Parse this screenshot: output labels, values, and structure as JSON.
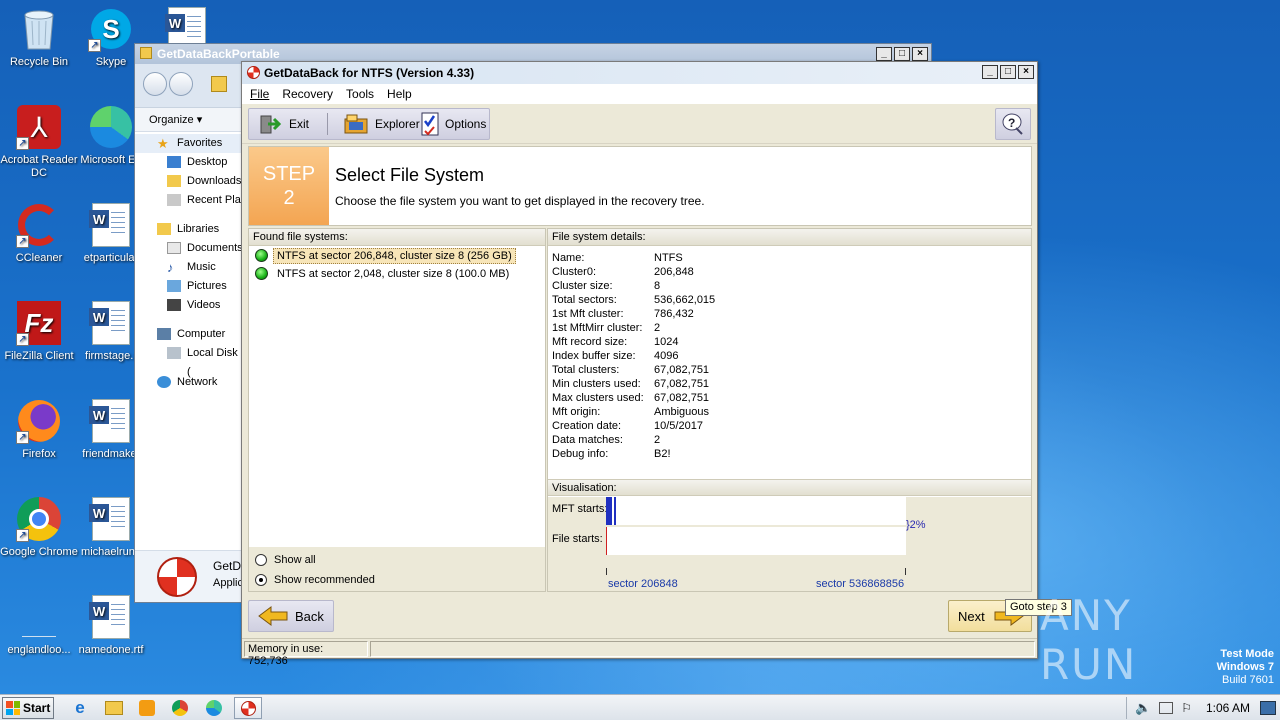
{
  "desktop": {
    "icons": [
      {
        "label": "Recycle Bin",
        "icon": "recycle-bin-icon"
      },
      {
        "label": "Skype",
        "icon": "skype-icon"
      },
      {
        "label": "Acrobat Reader DC",
        "icon": "acrobat-icon"
      },
      {
        "label": "Microsoft Ed",
        "icon": "edge-icon"
      },
      {
        "label": "CCleaner",
        "icon": "ccleaner-icon"
      },
      {
        "label": "etparticular",
        "icon": "word-doc-icon"
      },
      {
        "label": "FileZilla Client",
        "icon": "filezilla-icon"
      },
      {
        "label": "firmstage.r",
        "icon": "word-doc-icon"
      },
      {
        "label": "Firefox",
        "icon": "firefox-icon"
      },
      {
        "label": "friendmake.",
        "icon": "word-doc-icon"
      },
      {
        "label": "Google Chrome",
        "icon": "chrome-icon"
      },
      {
        "label": "michaelrunn",
        "icon": "word-doc-icon"
      },
      {
        "label": "englandloo...",
        "icon": "blank-file-icon"
      },
      {
        "label": "namedone.rtf",
        "icon": "word-doc-icon"
      }
    ],
    "watermark": "ANY RUN",
    "test_mode": {
      "line1": "Test Mode",
      "line2": "Windows 7",
      "line3": "Build 7601"
    }
  },
  "explorer": {
    "title": "GetDataBackPortable",
    "organize_label": "Organize",
    "nav": {
      "favorites": "Favorites",
      "desktop": "Desktop",
      "downloads": "Downloads",
      "recent": "Recent Pla",
      "libraries": "Libraries",
      "documents": "Documents",
      "music": "Music",
      "pictures": "Pictures",
      "videos": "Videos",
      "computer": "Computer",
      "local_disk": "Local Disk (",
      "network": "Network"
    },
    "details": {
      "name": "GetD",
      "type": "Applic"
    }
  },
  "gdb": {
    "title": "GetDataBack for NTFS (Version 4.33)",
    "menu": [
      "File",
      "Recovery",
      "Tools",
      "Help"
    ],
    "toolbar": {
      "exit": "Exit",
      "explorer": "Explorer",
      "options": "Options"
    },
    "step": {
      "word": "STEP",
      "number": "2"
    },
    "header_title": "Select File System",
    "header_desc": "Choose the file system you want to get displayed in the recovery tree.",
    "found_header": "Found file systems:",
    "file_systems": [
      {
        "label": "NTFS at sector 206,848, cluster size 8 (256 GB)",
        "selected": true
      },
      {
        "label": "NTFS at sector 2,048, cluster size 8 (100.0 MB)",
        "selected": false
      }
    ],
    "radio": {
      "show_all": "Show all",
      "show_recommended": "Show recommended",
      "selected": "show_recommended"
    },
    "details_header": "File system details:",
    "details": [
      {
        "k": "Name:",
        "v": "NTFS"
      },
      {
        "k": "Cluster0:",
        "v": "206,848"
      },
      {
        "k": "Cluster size:",
        "v": "8"
      },
      {
        "k": "Total sectors:",
        "v": "536,662,015"
      },
      {
        "k": "1st Mft cluster:",
        "v": "786,432"
      },
      {
        "k": "1st MftMirr cluster:",
        "v": "2"
      },
      {
        "k": "Mft record size:",
        "v": "1024"
      },
      {
        "k": "Index buffer size:",
        "v": "4096"
      },
      {
        "k": "Total clusters:",
        "v": "67,082,751"
      },
      {
        "k": "Min clusters used:",
        "v": "67,082,751"
      },
      {
        "k": "Max clusters used:",
        "v": "67,082,751"
      },
      {
        "k": "Mft origin:",
        "v": "Ambiguous"
      },
      {
        "k": "Creation date:",
        "v": "10/5/2017"
      },
      {
        "k": "Data matches:",
        "v": "2"
      },
      {
        "k": "Debug info:",
        "v": "B2!"
      }
    ],
    "visualisation": {
      "header": "Visualisation:",
      "mft_label": "MFT starts:",
      "file_label": "File starts:",
      "percent": "}2%",
      "sector_start": "sector 206848",
      "sector_end": "sector 536868856"
    },
    "back_label": "Back",
    "next_label": "Next",
    "tooltip": "Goto step 3",
    "status": "Memory in use: 752,736"
  },
  "taskbar": {
    "start_label": "Start",
    "clock": "1:06 AM"
  }
}
